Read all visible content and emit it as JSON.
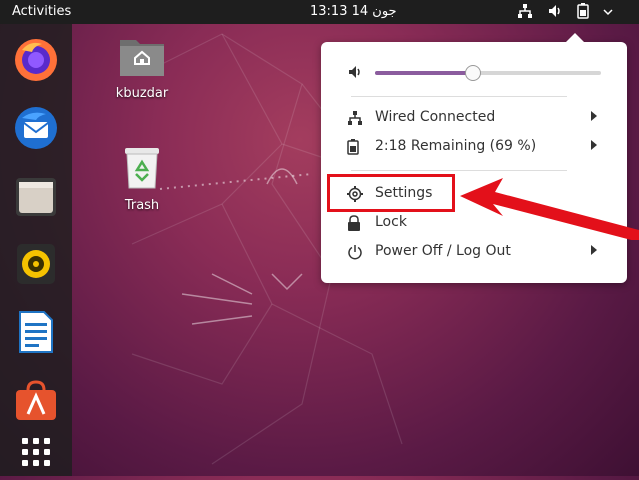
{
  "topbar": {
    "activities": "Activities",
    "clock": "13:13  14 جون",
    "tray_icons": [
      "network-icon",
      "volume-icon",
      "battery-icon",
      "chevron-down-icon"
    ]
  },
  "dock": {
    "items": [
      "firefox-icon",
      "thunderbird-icon",
      "files-icon",
      "rhythmbox-icon",
      "writer-icon",
      "software-icon",
      "apps-grid-icon"
    ]
  },
  "desktop": {
    "icons": [
      {
        "label": "kbuzdar"
      },
      {
        "label": "Trash"
      }
    ]
  },
  "menu": {
    "volume": {
      "level": 0.43
    },
    "items": [
      {
        "label": "Wired Connected"
      },
      {
        "label": "2:18 Remaining (69 %)"
      },
      {
        "label": "Settings"
      },
      {
        "label": "Lock"
      },
      {
        "label": "Power Off / Log Out"
      }
    ]
  },
  "colors": {
    "highlight": "#e3101a",
    "accent": "#8b5c9e"
  }
}
